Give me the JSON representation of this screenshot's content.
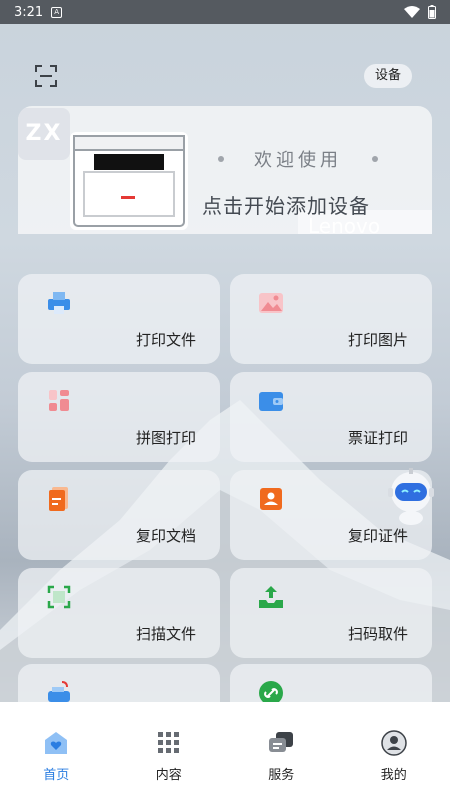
{
  "status_bar": {
    "time": "3:21",
    "notification_icon": "A"
  },
  "header": {
    "device_button_label": "设备"
  },
  "hero": {
    "badge": "ZX",
    "welcome": "欢迎使用",
    "add_device_text": "点击开始添加设备",
    "watermark": "Lenovo"
  },
  "features": [
    {
      "label": "打印文件",
      "icon": "print-file-icon",
      "color": "#3b8ee8"
    },
    {
      "label": "打印图片",
      "icon": "image-icon",
      "color": "#f08b92"
    },
    {
      "label": "拼图打印",
      "icon": "collage-icon",
      "color": "#f08b92"
    },
    {
      "label": "票证打印",
      "icon": "wallet-icon",
      "color": "#3b8ee8"
    },
    {
      "label": "复印文档",
      "icon": "document-icon",
      "color": "#f06a1e"
    },
    {
      "label": "复印证件",
      "icon": "id-card-icon",
      "color": "#f06a1e"
    },
    {
      "label": "扫描文件",
      "icon": "scan-frame-icon",
      "color": "#2aa84a"
    },
    {
      "label": "扫码取件",
      "icon": "tray-upload-icon",
      "color": "#2aa84a"
    },
    {
      "label": "",
      "icon": "printer-wifi-icon",
      "color": "#3b8ee8"
    },
    {
      "label": "",
      "icon": "link-icon",
      "color": "#2aa84a"
    }
  ],
  "tabs": [
    {
      "label": "首页",
      "icon": "home-heart-icon",
      "active": true
    },
    {
      "label": "内容",
      "icon": "grid-icon",
      "active": false
    },
    {
      "label": "服务",
      "icon": "chat-icon",
      "active": false
    },
    {
      "label": "我的",
      "icon": "profile-icon",
      "active": false
    }
  ],
  "colors": {
    "accent": "#2a7de1",
    "status_bar": "#555a60"
  }
}
